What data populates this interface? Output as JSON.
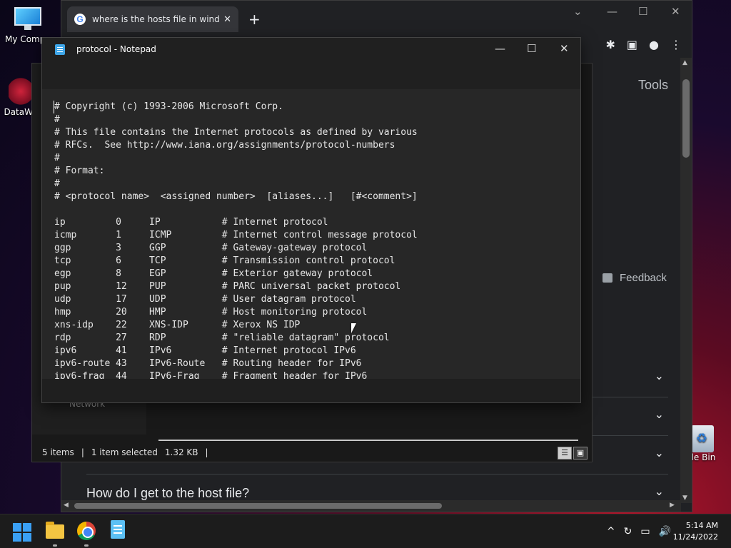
{
  "desktop": {
    "icons": [
      {
        "label": "My Compu"
      },
      {
        "label": "DataWa"
      }
    ],
    "recycle_label": "cle Bin"
  },
  "chrome": {
    "tab_title": "where is the hosts file in window",
    "tab_close": "✕",
    "new_tab": "+",
    "win_min": "—",
    "win_max": "☐",
    "win_close": "✕",
    "tools_label": "Tools",
    "feedback_label": "Feedback",
    "paa_question": "How do I get to the host file?",
    "chevron": "⌄",
    "scroll_up": "▲",
    "scroll_down": "▼",
    "scroll_left": "◀",
    "scroll_right": "▶"
  },
  "explorer": {
    "nav_item": "Network",
    "status_items": "5 items",
    "status_selected": "1 item selected",
    "status_size": "1.32 KB",
    "status_sep": "|"
  },
  "notepad": {
    "title": "protocol - Notepad",
    "min": "—",
    "max": "☐",
    "close": "✕",
    "content": "# Copyright (c) 1993-2006 Microsoft Corp.\n#\n# This file contains the Internet protocols as defined by various\n# RFCs.  See http://www.iana.org/assignments/protocol-numbers\n#\n# Format:\n#\n# <protocol name>  <assigned number>  [aliases...]   [#<comment>]\n\nip         0     IP           # Internet protocol\nicmp       1     ICMP         # Internet control message protocol\nggp        3     GGP          # Gateway-gateway protocol\ntcp        6     TCP          # Transmission control protocol\negp        8     EGP          # Exterior gateway protocol\npup        12    PUP          # PARC universal packet protocol\nudp        17    UDP          # User datagram protocol\nhmp        20    HMP          # Host monitoring protocol\nxns-idp    22    XNS-IDP      # Xerox NS IDP\nrdp        27    RDP          # \"reliable datagram\" protocol\nipv6       41    IPv6         # Internet protocol IPv6\nipv6-route 43    IPv6-Route   # Routing header for IPv6\nipv6-frag  44    IPv6-Frag    # Fragment header for IPv6"
  },
  "taskbar": {
    "time": "5:14 AM",
    "date": "11/24/2022",
    "tray_up": "^"
  }
}
